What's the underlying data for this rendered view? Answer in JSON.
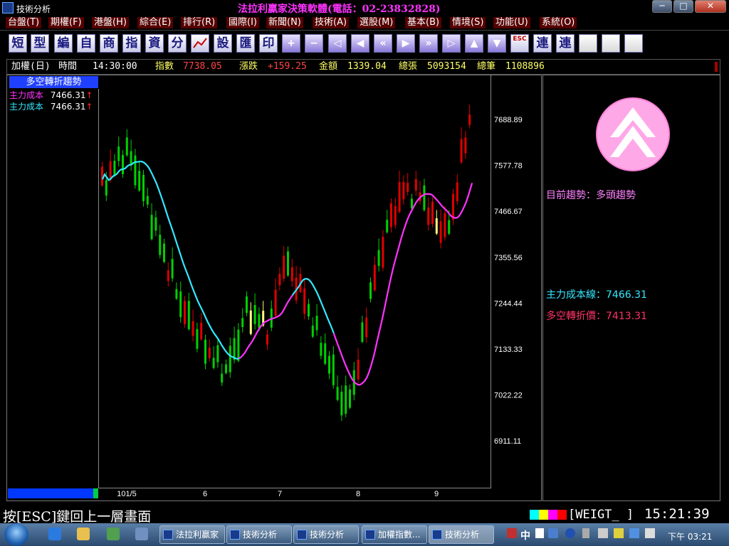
{
  "window": {
    "title": "技術分析",
    "vendor_banner": "法拉利贏家決策軟體(電話：02-23832828)",
    "min_label": "─",
    "max_label": "□",
    "close_label": "✕"
  },
  "menu": [
    {
      "label": "台盤(T)"
    },
    {
      "label": "期權(F)"
    },
    {
      "label": "港盤(H)"
    },
    {
      "label": "綜合(E)"
    },
    {
      "label": "排行(R)"
    },
    {
      "label": "國際(I)"
    },
    {
      "label": "新聞(N)"
    },
    {
      "label": "技術(A)"
    },
    {
      "label": "選股(M)"
    },
    {
      "label": "基本(B)"
    },
    {
      "label": "情境(S)"
    },
    {
      "label": "功能(U)"
    },
    {
      "label": "系統(O)"
    }
  ],
  "toolbar": [
    {
      "label": "短",
      "icon": "short-icon"
    },
    {
      "label": "型",
      "icon": "pattern-icon"
    },
    {
      "label": "編",
      "icon": "edit-icon"
    },
    {
      "label": "自",
      "icon": "custom-icon"
    },
    {
      "label": "商",
      "icon": "commodity-icon"
    },
    {
      "label": "指",
      "icon": "indicator-icon"
    },
    {
      "label": "資",
      "icon": "data-icon"
    },
    {
      "label": "分",
      "icon": "split-icon"
    },
    {
      "label": "",
      "icon": "chart-icon"
    },
    {
      "label": "設",
      "icon": "settings-icon"
    },
    {
      "label": "匯",
      "icon": "export-icon"
    },
    {
      "label": "印",
      "icon": "print-icon"
    },
    {
      "label": "+",
      "icon": "zoom-in-icon"
    },
    {
      "label": "−",
      "icon": "zoom-out-icon"
    },
    {
      "label": "◁",
      "icon": "step-left-icon"
    },
    {
      "label": "◀",
      "icon": "left-icon"
    },
    {
      "label": "«",
      "icon": "fast-left-icon"
    },
    {
      "label": "▶",
      "icon": "right-icon"
    },
    {
      "label": "»",
      "icon": "fast-right-icon"
    },
    {
      "label": "▷",
      "icon": "step-right-icon"
    },
    {
      "label": "▲",
      "icon": "up-icon"
    },
    {
      "label": "▼",
      "icon": "down-icon"
    },
    {
      "label": "ESC",
      "icon": "escape-icon"
    },
    {
      "label": "連",
      "icon": "link-icon"
    },
    {
      "label": "連",
      "icon": "link2-icon"
    },
    {
      "label": "",
      "icon": "window-icon"
    },
    {
      "label": "",
      "icon": "lock-icon"
    },
    {
      "label": "",
      "icon": "fan-icon"
    }
  ],
  "info_strip": {
    "symbol": "加權(日)",
    "time_label": "時間",
    "time_value": "14:30:00",
    "index_label": "指數",
    "index_value": "7738.05",
    "change_label": "漲跌",
    "change_value": "+159.25",
    "amount_label": "金額",
    "amount_value": "1339.04",
    "lots_label": "總張",
    "lots_value": "5093154",
    "count_label": "總筆",
    "count_value": "1108896"
  },
  "indicator": {
    "title": "多空轉折趨勢",
    "legend": [
      {
        "label": "主力成本",
        "value": "7466.31",
        "arrow": "↑",
        "color": "#ff33ff"
      },
      {
        "label": "主力成本",
        "value": "7466.31",
        "arrow": "↑",
        "color": "#33e8ff"
      }
    ]
  },
  "chart_data": {
    "type": "candlestick",
    "y_ticks": [
      "7688.89",
      "7577.78",
      "7466.67",
      "7355.56",
      "7244.44",
      "7133.33",
      "7022.22",
      "6911.11"
    ],
    "ylim": [
      6850,
      7750
    ],
    "x_ticks": [
      "101/5",
      "6",
      "7",
      "8",
      "9"
    ],
    "colors": {
      "up": "#e00000",
      "down": "#00d000",
      "neutral": "#ffff80",
      "line_bear": "#33e8ff",
      "line_bull": "#ff33ff"
    }
  },
  "right_panel": {
    "trend_label": "目前趨勢：多頭趨勢",
    "cost_line_label": "主力成本線：7466.31",
    "turning_price_label": "多空轉折價：7413.31",
    "trend_icon": "double-up-chevron-icon"
  },
  "status": {
    "hint": "按[ESC]鍵回上一層畫面",
    "symbol_code": "[WEIGT_ ]",
    "clock": "15:21:39",
    "colors": [
      "#00ffff",
      "#ffff00",
      "#ff00ff",
      "#ff0000"
    ]
  },
  "taskbar": {
    "tasks": [
      {
        "label": "法拉利贏家"
      },
      {
        "label": "技術分析"
      },
      {
        "label": "技術分析"
      },
      {
        "label": "加權指數..."
      },
      {
        "label": "技術分析"
      }
    ],
    "ime": "中",
    "time": "下午 03:21"
  }
}
